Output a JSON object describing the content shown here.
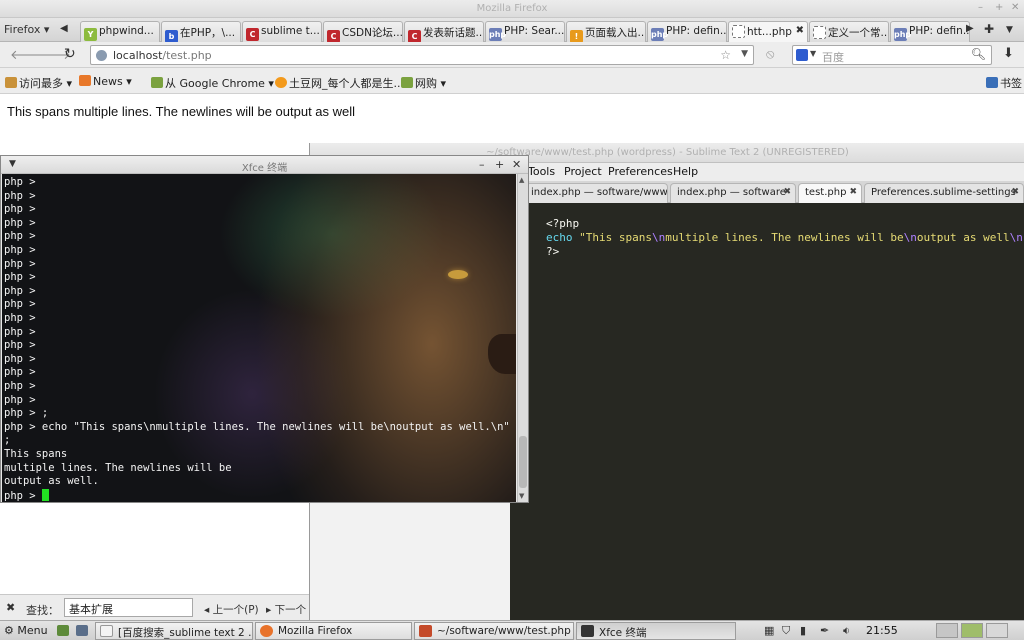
{
  "firefox": {
    "window_title": "Mozilla Firefox",
    "menu_button": "Firefox ▾",
    "tabs": [
      {
        "label": "phpwind...",
        "icon": "phpwind-icon"
      },
      {
        "label": "在PHP，\\...",
        "icon": "baidu-icon"
      },
      {
        "label": "sublime t...",
        "icon": "csdn-icon"
      },
      {
        "label": "CSDN论坛...",
        "icon": "csdn-icon"
      },
      {
        "label": "发表新话题...",
        "icon": "csdn-icon"
      },
      {
        "label": "PHP: Sear...",
        "icon": "php-icon"
      },
      {
        "label": "页面载入出...",
        "icon": "warning-icon"
      },
      {
        "label": "PHP: defin...",
        "icon": "php-icon"
      },
      {
        "label": "htt...php",
        "icon": "blank-page-icon",
        "active": true
      },
      {
        "label": "定义一个常...",
        "icon": "blank-page-icon"
      },
      {
        "label": "PHP: defin...",
        "icon": "php-icon"
      }
    ],
    "url": {
      "host": "localhost",
      "path": "/test.php"
    },
    "search_placeholder": "百度",
    "bookmarks": [
      "访问最多 ▾",
      "News ▾",
      "从 Google Chrome ▾",
      "土豆网_每个人都是生...",
      "网购 ▾"
    ],
    "bookmarks_right": "书签",
    "page_text": "This spans multiple lines. The newlines will be output as well",
    "findbar": {
      "label": "查找：",
      "value": "基本扩展",
      "prev": "◂ 上一个(P)",
      "next": "▸ 下一个"
    }
  },
  "sublime": {
    "title": "~/software/www/test.php (wordpress) - Sublime Text 2 (UNREGISTERED)",
    "menu": [
      "Tools",
      "Project",
      "Preferences",
      "Help"
    ],
    "tabs": [
      {
        "label": "index.php — software/www/w"
      },
      {
        "label": "index.php — software"
      },
      {
        "label": "test.php",
        "active": true
      },
      {
        "label": "Preferences.sublime-settings"
      }
    ],
    "code": {
      "open_tag": "<?php",
      "echo": "echo",
      "str_a": "\"This spans",
      "esc_n": "\\n",
      "str_b": "multiple lines. The newlines will be",
      "str_c": "output as well",
      "str_d": "\";",
      "close_tag": "?>"
    }
  },
  "terminal": {
    "title": "Xfce 终端",
    "prompt": "php >",
    "empty_prompt_count": 17,
    "lines": [
      "php > ;",
      "php > echo \"This spans\\nmultiple lines. The newlines will be\\noutput as well.\\n\"",
      ";",
      "This spans",
      "multiple lines. The newlines will be",
      "output as well.",
      "php > "
    ]
  },
  "panel": {
    "menu": "Menu",
    "tasks": [
      {
        "label": "[百度搜索_sublime text 2 ...",
        "icon": "document-icon"
      },
      {
        "label": "Mozilla Firefox",
        "icon": "firefox-icon"
      },
      {
        "label": "~/software/www/test.php (...",
        "icon": "sublime-icon"
      },
      {
        "label": "Xfce 终端",
        "icon": "terminal-icon",
        "active": true
      }
    ],
    "clock": "21:55"
  }
}
